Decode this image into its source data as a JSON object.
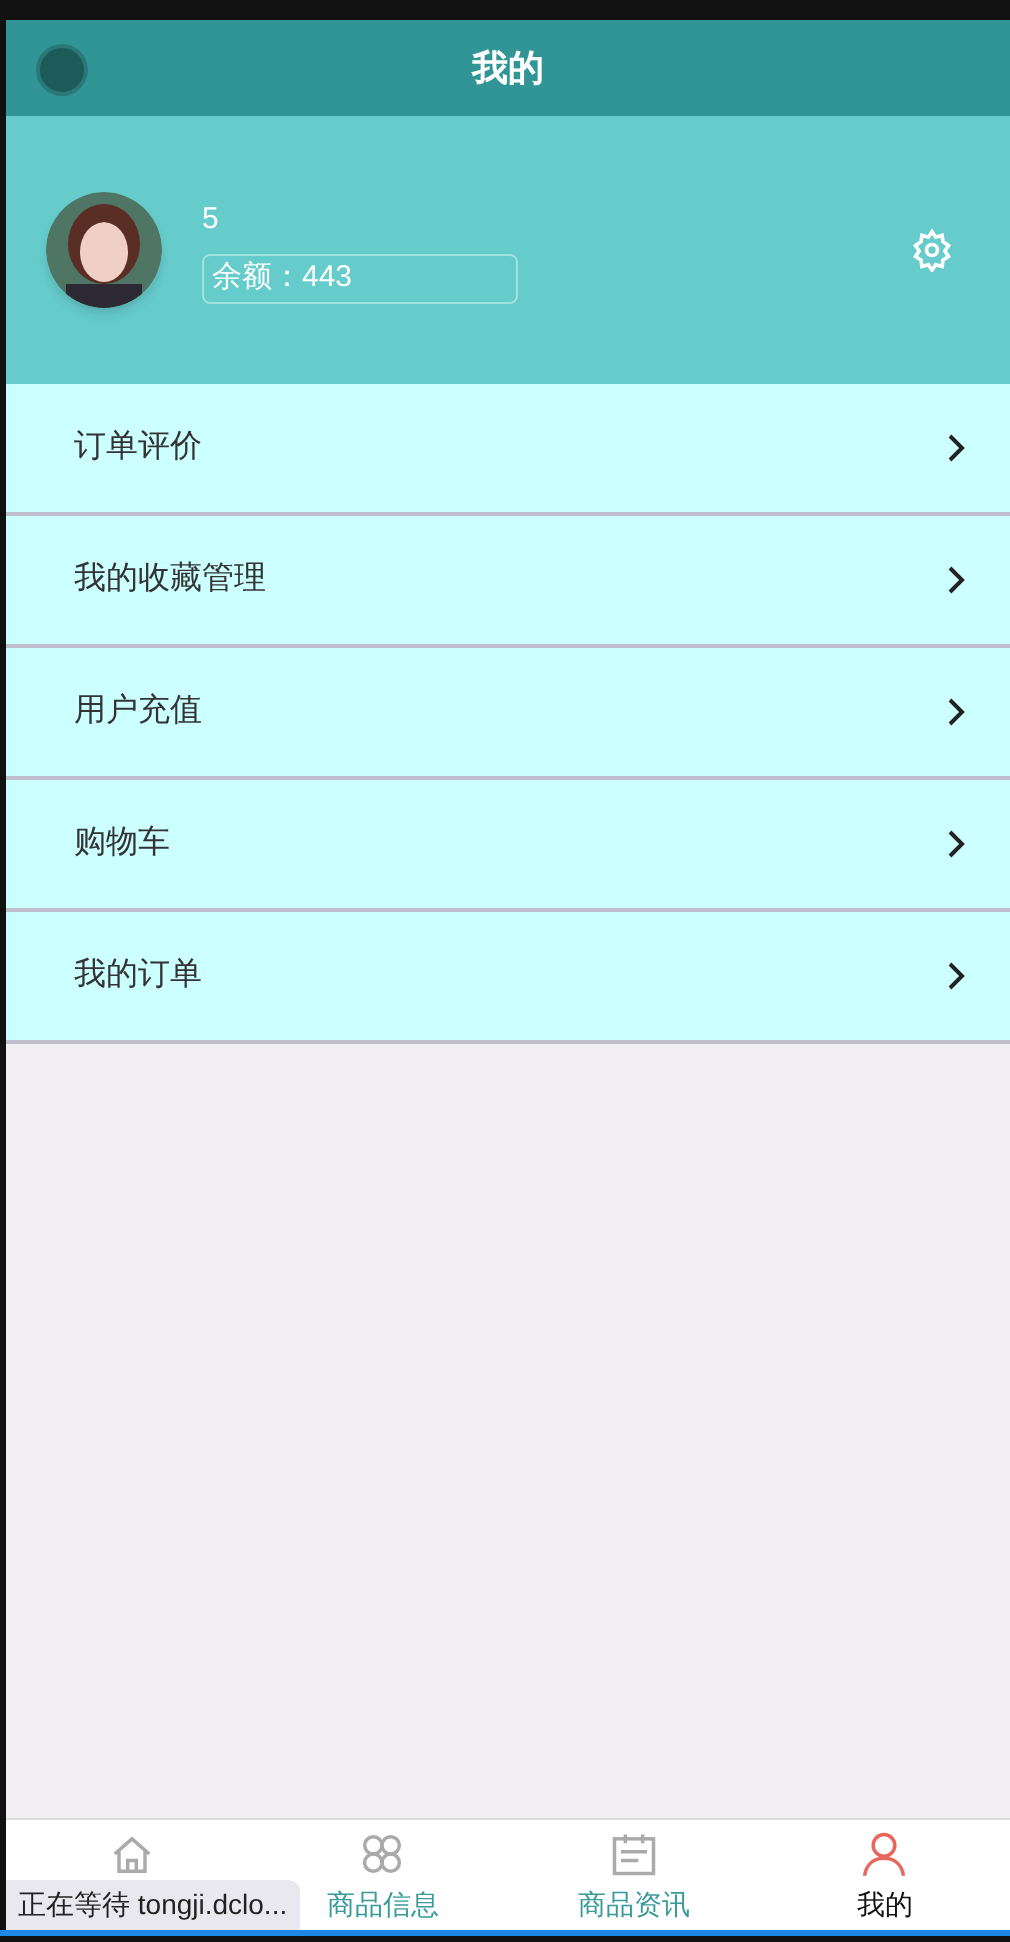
{
  "header": {
    "title": "我的"
  },
  "profile": {
    "name": "5",
    "balance": "余额：443"
  },
  "menu": [
    {
      "label": "订单评价"
    },
    {
      "label": "我的收藏管理"
    },
    {
      "label": "用户充值"
    },
    {
      "label": "购物车"
    },
    {
      "label": "我的订单"
    }
  ],
  "tab_bar": [
    {
      "selected": false
    },
    {
      "label": "商品信息",
      "selected": false
    },
    {
      "label": "商品资讯",
      "selected": false
    },
    {
      "label": "我的",
      "selected": true
    }
  ],
  "browser_status": "正在等待 tongji.dclo..."
}
